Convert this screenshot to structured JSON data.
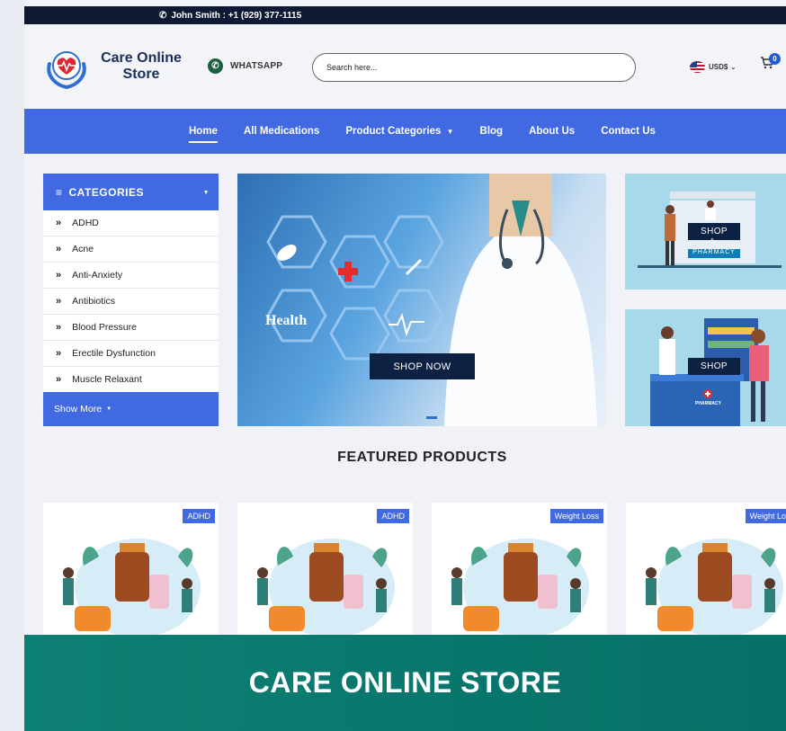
{
  "topbar": {
    "contact": "John Smith : +1 (929) 377-1115"
  },
  "header": {
    "logo_line1": "Care Online",
    "logo_line2": "Store",
    "whatsapp_label": "WHATSAPP",
    "search_placeholder": "Search here...",
    "currency": "USD$",
    "cart_count": "0"
  },
  "nav": {
    "items": [
      "Home",
      "All Medications",
      "Product Categories",
      "Blog",
      "About Us",
      "Contact Us"
    ]
  },
  "categories": {
    "title": "CATEGORIES",
    "items": [
      "ADHD",
      "Acne",
      "Anti-Anxiety",
      "Antibiotics",
      "Blood Pressure",
      "Erectile Dysfunction",
      "Muscle Relaxant"
    ],
    "show_more": "Show More"
  },
  "hero": {
    "health_label": "Health",
    "cta": "SHOP NOW"
  },
  "promos": [
    {
      "cta": "SHOP",
      "plus": "+",
      "sub": "PHARMACY"
    },
    {
      "cta": "SHOP",
      "sub": "PHARMACY"
    }
  ],
  "featured": {
    "title": "FEATURED PRODUCTS",
    "products": [
      {
        "tag": "ADHD"
      },
      {
        "tag": "ADHD"
      },
      {
        "tag": "Weight Loss"
      },
      {
        "tag": "Weight Loss"
      }
    ]
  },
  "footer": {
    "title": "CARE ONLINE STORE"
  },
  "colors": {
    "primary": "#4169e1",
    "topbar": "#0e1a33",
    "footer": "#0b7a70"
  }
}
